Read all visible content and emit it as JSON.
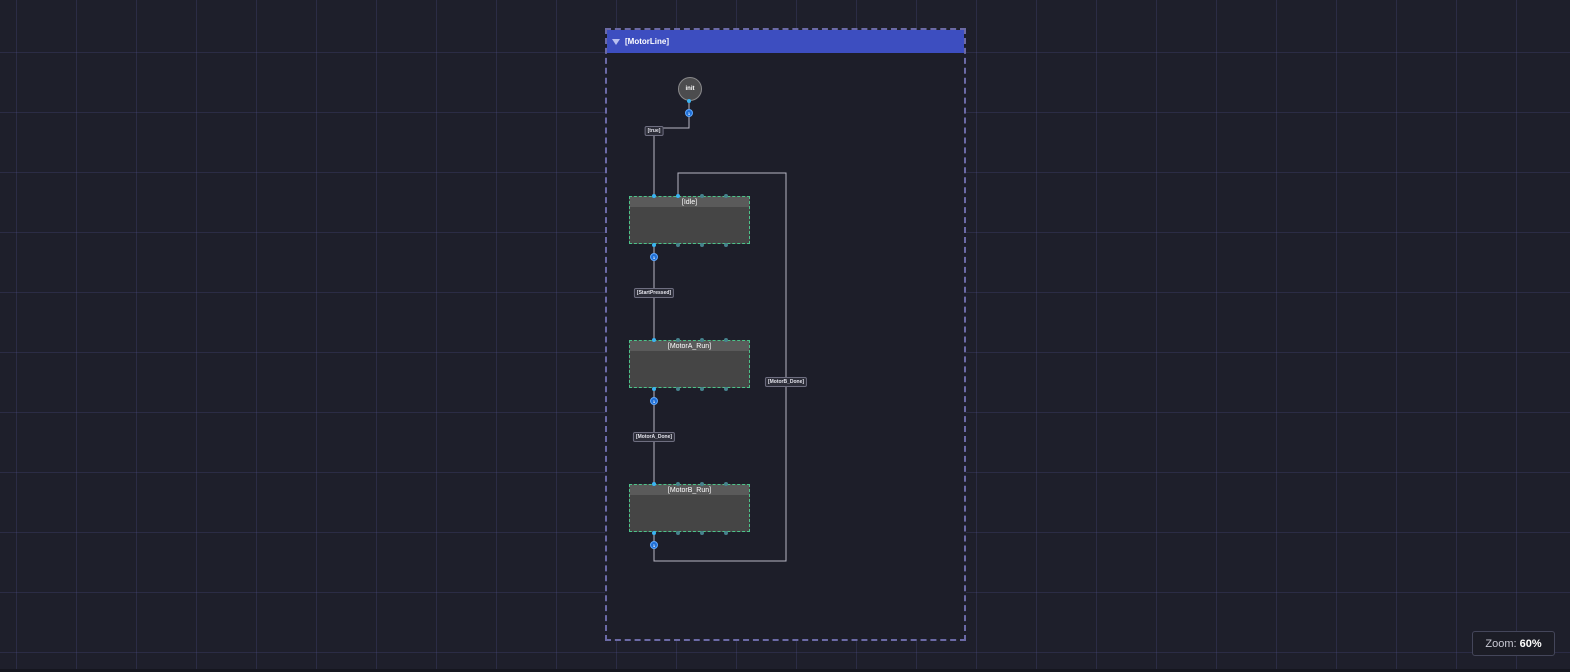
{
  "group": {
    "title": "[MotorLine]"
  },
  "initial_node": {
    "label": "init"
  },
  "states": [
    {
      "id": "idle",
      "label": "[Idle]"
    },
    {
      "id": "motora",
      "label": "[MotorA_Run]"
    },
    {
      "id": "motorb",
      "label": "[MotorB_Run]"
    }
  ],
  "transitions": [
    {
      "label": "[true]",
      "badge": "1"
    },
    {
      "label": "[StartPressed]",
      "badge": "1"
    },
    {
      "label": "[MotorA_Done]",
      "badge": "1"
    },
    {
      "label": "[MotorB_Done]",
      "badge": "1"
    }
  ],
  "zoom": {
    "label": "Zoom:",
    "value": "60%"
  },
  "colors": {
    "canvas_background": "#1e1f2b",
    "group_header": "#3d4ec0",
    "state_border": "#4cc38a",
    "handle": "#3ab4f2",
    "badge": "#1f6fd6"
  }
}
